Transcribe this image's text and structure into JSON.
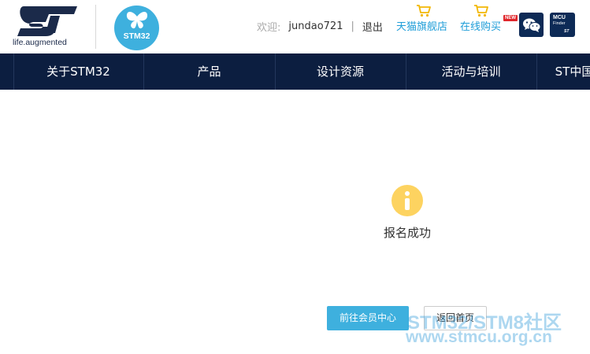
{
  "header": {
    "logo_tagline": "life.augmented",
    "stm32_logo_text": "STM32",
    "welcome_label": "欢迎:",
    "username": "jundao721",
    "separator": "|",
    "logout_label": "退出",
    "tmall_shop_label": "天猫旗舰店",
    "online_shop_label": "在线购买",
    "new_badge": "NEW",
    "mcu_finder": {
      "line1": "MCU",
      "line2": "Finder",
      "line3": "ST"
    }
  },
  "nav": {
    "items": [
      {
        "label": "关于STM32"
      },
      {
        "label": "产品"
      },
      {
        "label": "设计资源"
      },
      {
        "label": "活动与培训"
      },
      {
        "label": "ST中国"
      }
    ]
  },
  "main": {
    "message": "报名成功",
    "primary_button": "前往会员中心",
    "secondary_button": "返回首页"
  },
  "watermark": {
    "line1": "STM32/STM8社区",
    "line2": "www.stmcu.org.cn"
  },
  "colors": {
    "nav_bg": "#0c1e40",
    "accent": "#3eb0de",
    "info_icon": "#fdd360",
    "link": "#1e9dd8"
  }
}
